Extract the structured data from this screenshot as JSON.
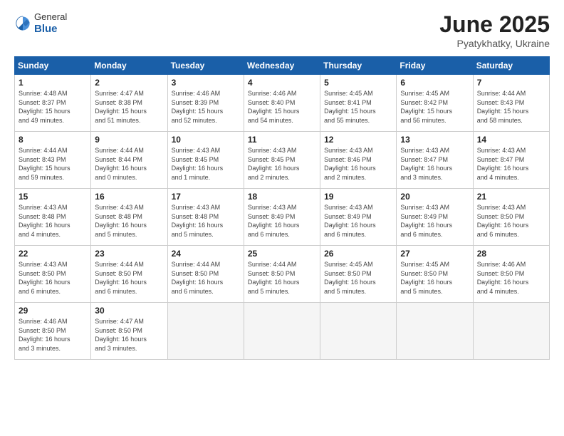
{
  "logo": {
    "general": "General",
    "blue": "Blue"
  },
  "title": "June 2025",
  "subtitle": "Pyatykhatky, Ukraine",
  "weekdays": [
    "Sunday",
    "Monday",
    "Tuesday",
    "Wednesday",
    "Thursday",
    "Friday",
    "Saturday"
  ],
  "weeks": [
    [
      {
        "day": "1",
        "info": "Sunrise: 4:48 AM\nSunset: 8:37 PM\nDaylight: 15 hours\nand 49 minutes."
      },
      {
        "day": "2",
        "info": "Sunrise: 4:47 AM\nSunset: 8:38 PM\nDaylight: 15 hours\nand 51 minutes."
      },
      {
        "day": "3",
        "info": "Sunrise: 4:46 AM\nSunset: 8:39 PM\nDaylight: 15 hours\nand 52 minutes."
      },
      {
        "day": "4",
        "info": "Sunrise: 4:46 AM\nSunset: 8:40 PM\nDaylight: 15 hours\nand 54 minutes."
      },
      {
        "day": "5",
        "info": "Sunrise: 4:45 AM\nSunset: 8:41 PM\nDaylight: 15 hours\nand 55 minutes."
      },
      {
        "day": "6",
        "info": "Sunrise: 4:45 AM\nSunset: 8:42 PM\nDaylight: 15 hours\nand 56 minutes."
      },
      {
        "day": "7",
        "info": "Sunrise: 4:44 AM\nSunset: 8:43 PM\nDaylight: 15 hours\nand 58 minutes."
      }
    ],
    [
      {
        "day": "8",
        "info": "Sunrise: 4:44 AM\nSunset: 8:43 PM\nDaylight: 15 hours\nand 59 minutes."
      },
      {
        "day": "9",
        "info": "Sunrise: 4:44 AM\nSunset: 8:44 PM\nDaylight: 16 hours\nand 0 minutes."
      },
      {
        "day": "10",
        "info": "Sunrise: 4:43 AM\nSunset: 8:45 PM\nDaylight: 16 hours\nand 1 minute."
      },
      {
        "day": "11",
        "info": "Sunrise: 4:43 AM\nSunset: 8:45 PM\nDaylight: 16 hours\nand 2 minutes."
      },
      {
        "day": "12",
        "info": "Sunrise: 4:43 AM\nSunset: 8:46 PM\nDaylight: 16 hours\nand 2 minutes."
      },
      {
        "day": "13",
        "info": "Sunrise: 4:43 AM\nSunset: 8:47 PM\nDaylight: 16 hours\nand 3 minutes."
      },
      {
        "day": "14",
        "info": "Sunrise: 4:43 AM\nSunset: 8:47 PM\nDaylight: 16 hours\nand 4 minutes."
      }
    ],
    [
      {
        "day": "15",
        "info": "Sunrise: 4:43 AM\nSunset: 8:48 PM\nDaylight: 16 hours\nand 4 minutes."
      },
      {
        "day": "16",
        "info": "Sunrise: 4:43 AM\nSunset: 8:48 PM\nDaylight: 16 hours\nand 5 minutes."
      },
      {
        "day": "17",
        "info": "Sunrise: 4:43 AM\nSunset: 8:48 PM\nDaylight: 16 hours\nand 5 minutes."
      },
      {
        "day": "18",
        "info": "Sunrise: 4:43 AM\nSunset: 8:49 PM\nDaylight: 16 hours\nand 6 minutes."
      },
      {
        "day": "19",
        "info": "Sunrise: 4:43 AM\nSunset: 8:49 PM\nDaylight: 16 hours\nand 6 minutes."
      },
      {
        "day": "20",
        "info": "Sunrise: 4:43 AM\nSunset: 8:49 PM\nDaylight: 16 hours\nand 6 minutes."
      },
      {
        "day": "21",
        "info": "Sunrise: 4:43 AM\nSunset: 8:50 PM\nDaylight: 16 hours\nand 6 minutes."
      }
    ],
    [
      {
        "day": "22",
        "info": "Sunrise: 4:43 AM\nSunset: 8:50 PM\nDaylight: 16 hours\nand 6 minutes."
      },
      {
        "day": "23",
        "info": "Sunrise: 4:44 AM\nSunset: 8:50 PM\nDaylight: 16 hours\nand 6 minutes."
      },
      {
        "day": "24",
        "info": "Sunrise: 4:44 AM\nSunset: 8:50 PM\nDaylight: 16 hours\nand 6 minutes."
      },
      {
        "day": "25",
        "info": "Sunrise: 4:44 AM\nSunset: 8:50 PM\nDaylight: 16 hours\nand 5 minutes."
      },
      {
        "day": "26",
        "info": "Sunrise: 4:45 AM\nSunset: 8:50 PM\nDaylight: 16 hours\nand 5 minutes."
      },
      {
        "day": "27",
        "info": "Sunrise: 4:45 AM\nSunset: 8:50 PM\nDaylight: 16 hours\nand 5 minutes."
      },
      {
        "day": "28",
        "info": "Sunrise: 4:46 AM\nSunset: 8:50 PM\nDaylight: 16 hours\nand 4 minutes."
      }
    ],
    [
      {
        "day": "29",
        "info": "Sunrise: 4:46 AM\nSunset: 8:50 PM\nDaylight: 16 hours\nand 3 minutes."
      },
      {
        "day": "30",
        "info": "Sunrise: 4:47 AM\nSunset: 8:50 PM\nDaylight: 16 hours\nand 3 minutes."
      },
      {
        "day": "",
        "info": ""
      },
      {
        "day": "",
        "info": ""
      },
      {
        "day": "",
        "info": ""
      },
      {
        "day": "",
        "info": ""
      },
      {
        "day": "",
        "info": ""
      }
    ]
  ]
}
